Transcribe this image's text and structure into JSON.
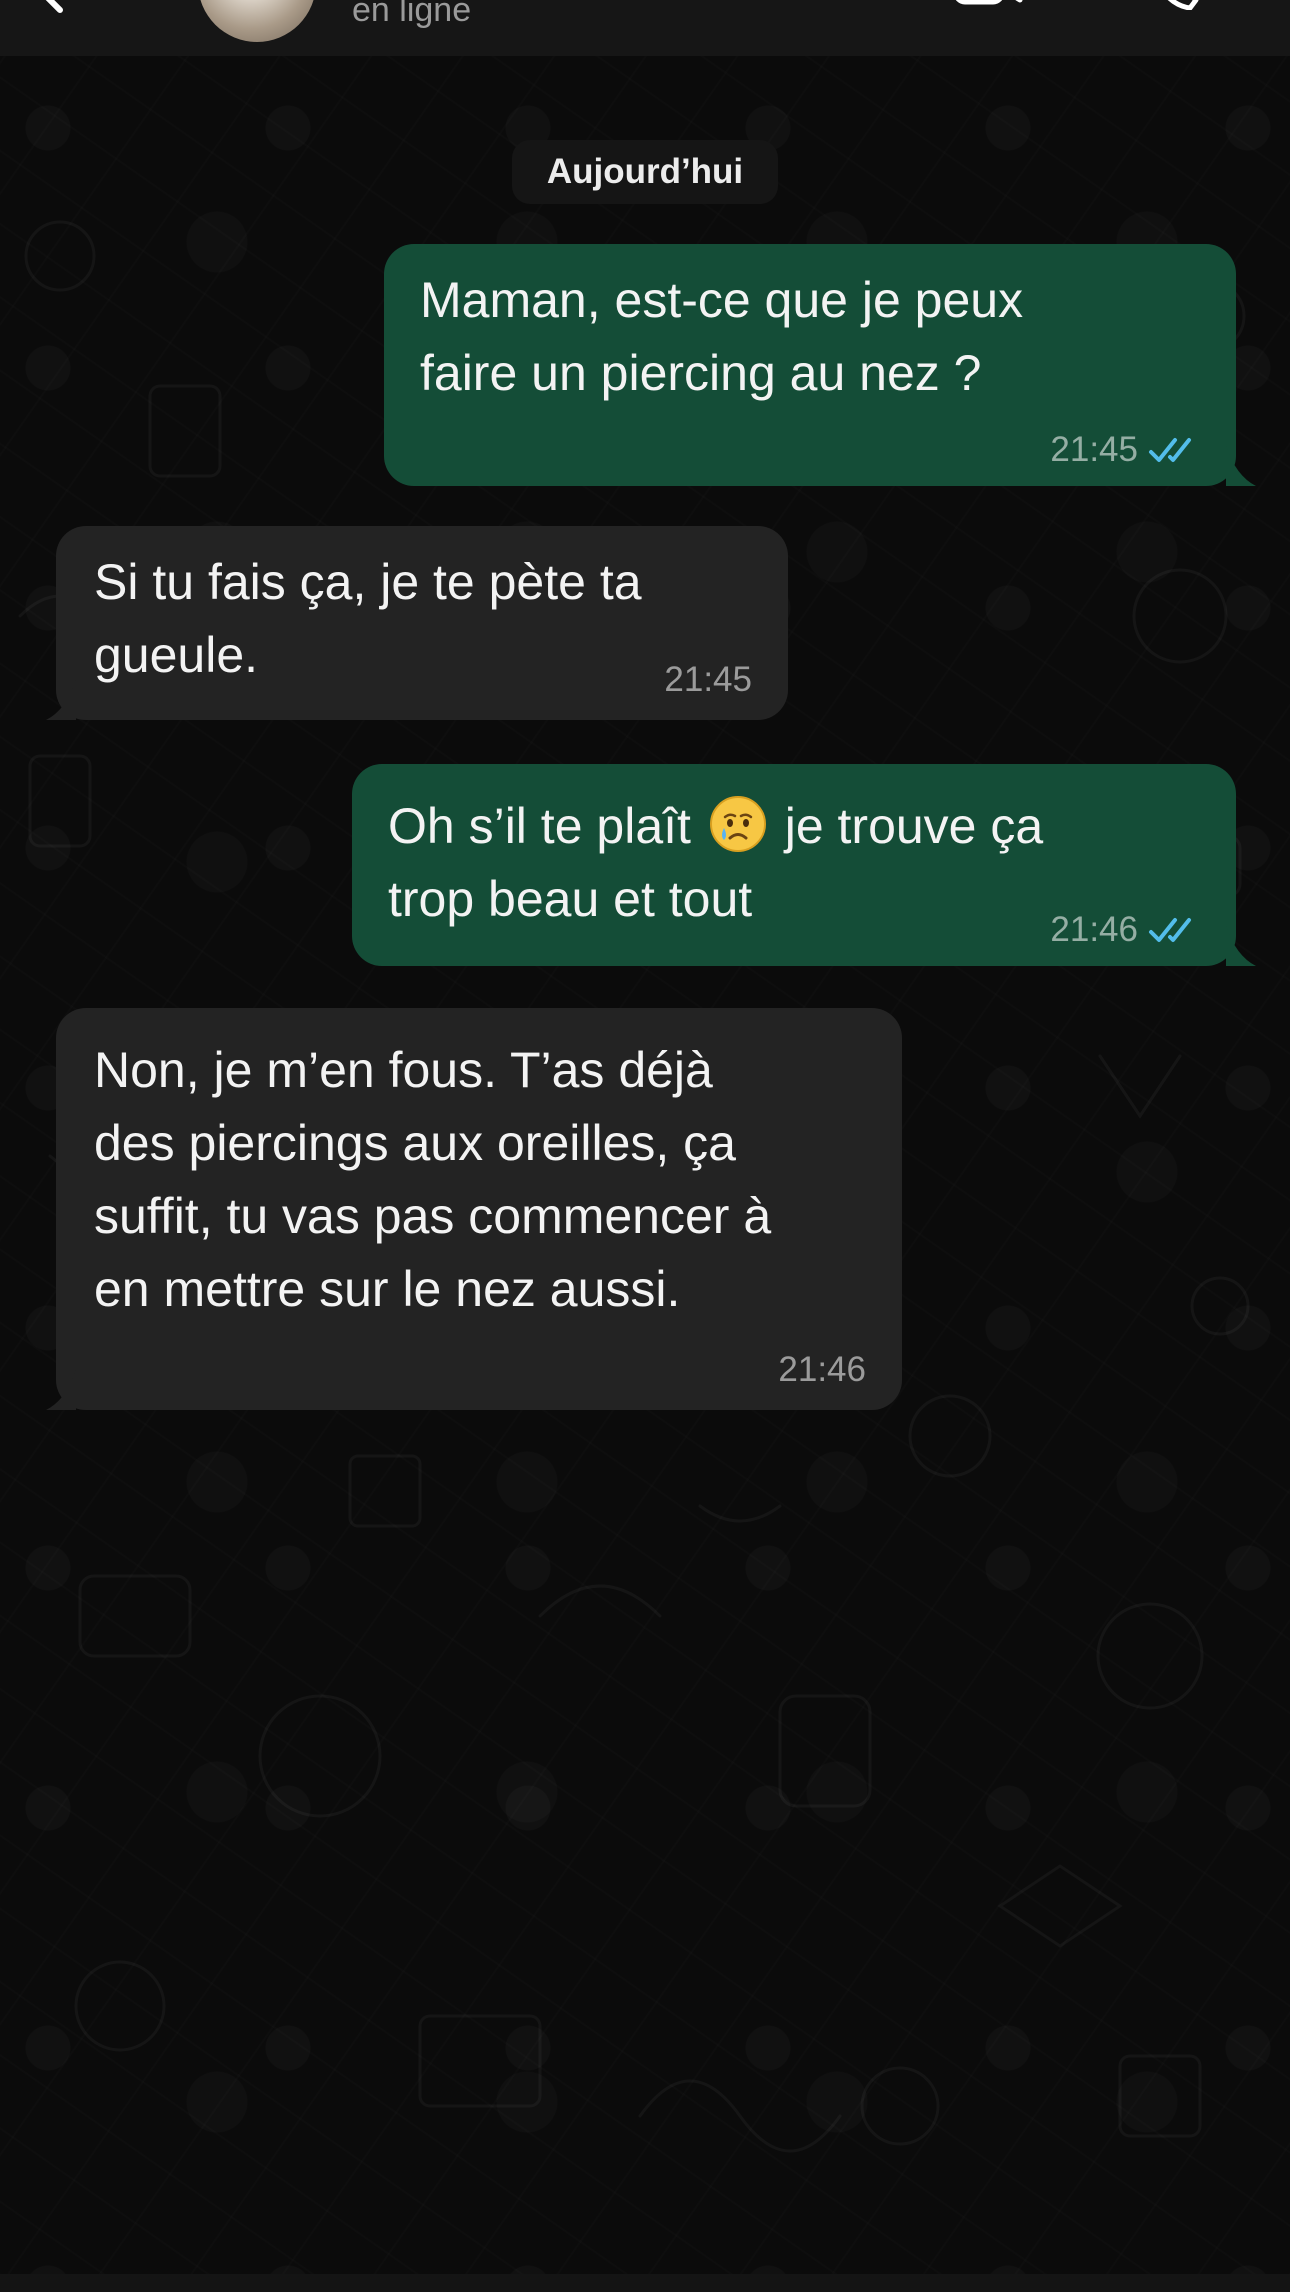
{
  "header": {
    "status": "en ligne",
    "back_icon": "chevron-left-icon",
    "video_icon": "video-camera-icon",
    "call_icon": "phone-icon"
  },
  "date_separator": "Aujourd’hui",
  "messages": [
    {
      "direction": "outgoing",
      "line1": "Maman, est-ce que je peux",
      "line2": "faire un piercing au nez ?",
      "time": "21:45",
      "read": true
    },
    {
      "direction": "incoming",
      "line1": "Si tu fais ça, je te pète ta",
      "line2": "gueule.",
      "time": "21:45"
    },
    {
      "direction": "outgoing",
      "line1_before_emoji": "Oh s’il te plaît",
      "emoji": "crying-face",
      "line1_after_emoji": "je trouve ça",
      "line2": "trop beau et tout",
      "time": "21:46",
      "read": true
    },
    {
      "direction": "incoming",
      "line1": "Non, je m’en fous. T’as déjà",
      "line2": "des piercings aux oreilles, ça",
      "line3": "suffit, tu vas pas commencer à",
      "line4": "en mettre sur le nez aussi.",
      "time": "21:46"
    }
  ],
  "colors": {
    "outgoing_bubble": "#144d37",
    "incoming_bubble": "#232323",
    "read_ticks": "#53bdeb",
    "background": "#0b0b0b"
  }
}
